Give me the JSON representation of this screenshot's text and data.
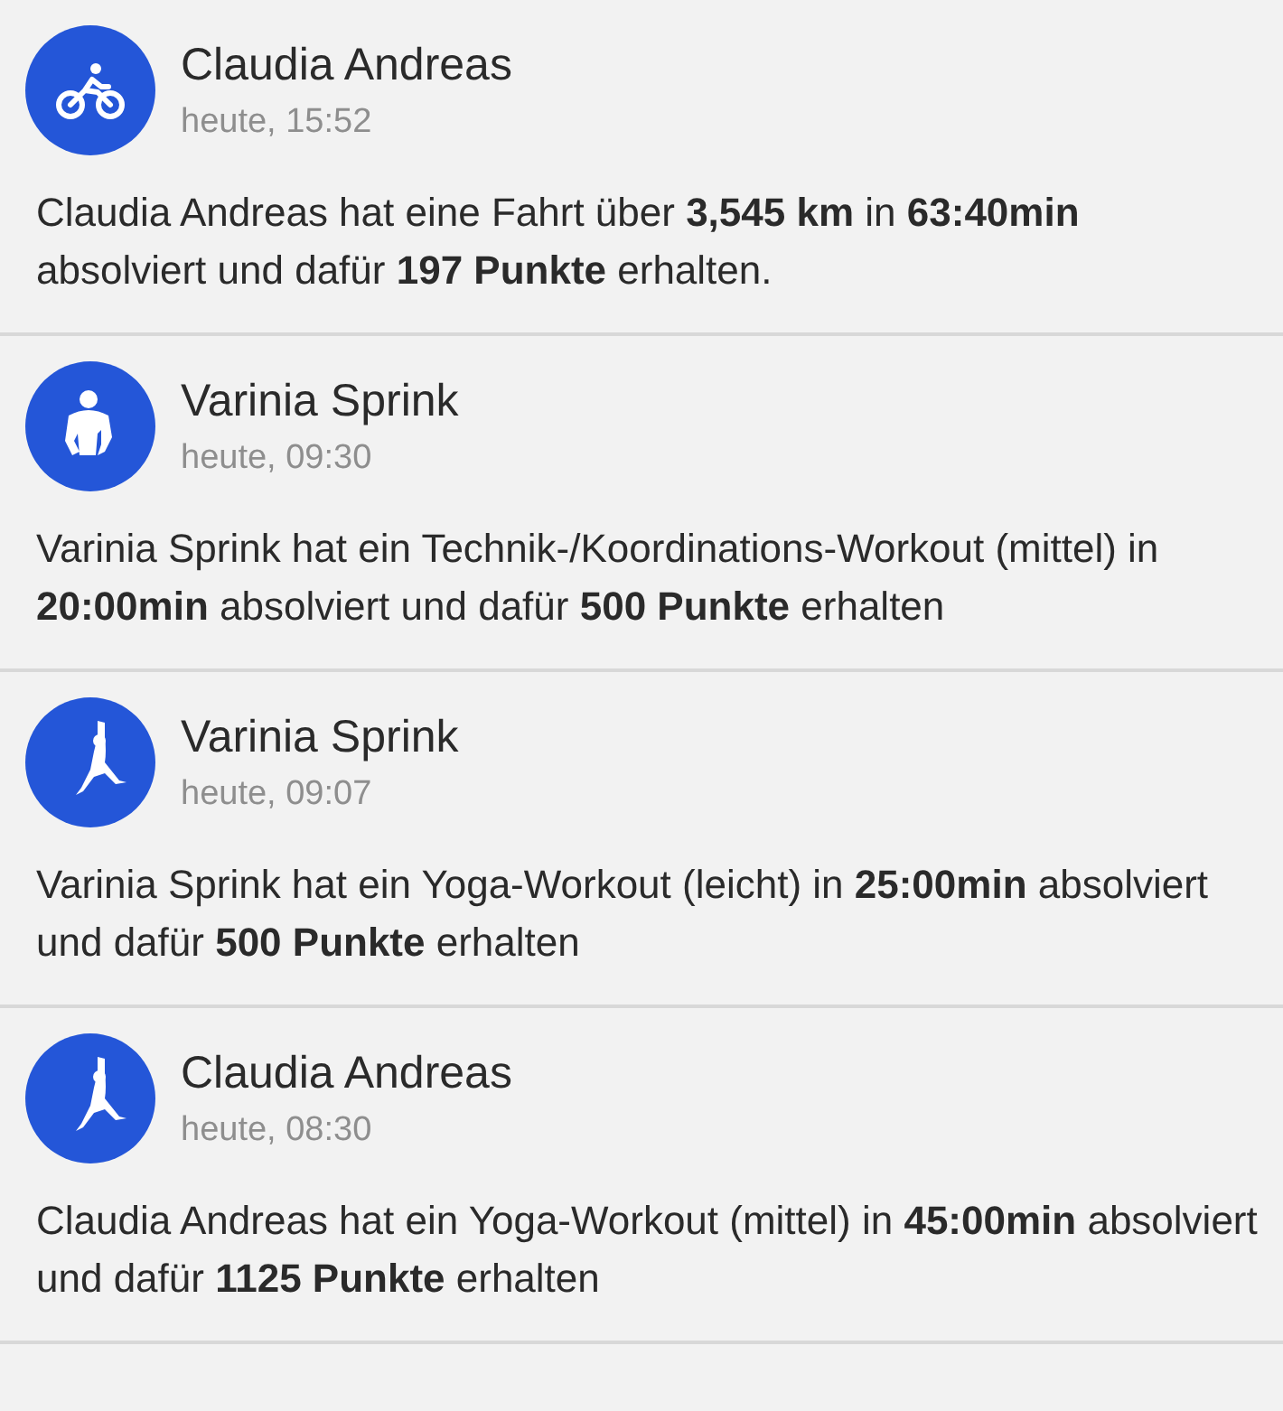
{
  "feed": [
    {
      "kind": "cycling",
      "name": "Claudia Andreas",
      "time": "heute, 15:52",
      "message": "Claudia Andreas hat eine Fahrt über **3,545 km** in **63:40min** absolviert und dafür **197 Punkte** erhalten."
    },
    {
      "kind": "fitness",
      "name": "Varinia Sprink",
      "time": "heute, 09:30",
      "message": "Varinia Sprink hat ein Technik-/Koordinations-Workout (mittel) in **20:00min** absolviert und dafür **500 Punkte** erhalten"
    },
    {
      "kind": "yoga",
      "name": "Varinia Sprink",
      "time": "heute, 09:07",
      "message": "Varinia Sprink hat ein Yoga-Workout (leicht) in **25:00min** absolviert und dafür **500 Punkte** erhalten"
    },
    {
      "kind": "yoga",
      "name": "Claudia Andreas",
      "time": "heute, 08:30",
      "message": "Claudia Andreas hat ein Yoga-Workout (mittel) in **45:00min** absolviert und dafür **1125 Punkte** erhalten"
    }
  ]
}
